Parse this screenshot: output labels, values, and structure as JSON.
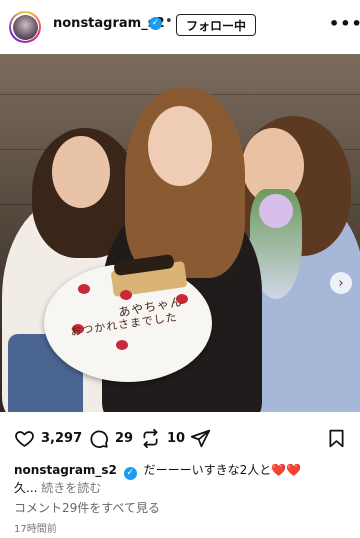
{
  "post": {
    "username": "nonstagram_s2",
    "verified_mark": "✓",
    "separator": "•",
    "follow_button": "フォロー中",
    "more_menu": "•••"
  },
  "photo": {
    "plate_text_line1": "あやちゃん",
    "plate_text_line2": "おつかれさまでした",
    "carousel_next": "›",
    "carousel_pages": 3,
    "carousel_active": 1
  },
  "actions": {
    "likes": "3,297",
    "comments": "29",
    "reposts": "10"
  },
  "caption": {
    "username": "nonstagram_s2",
    "text_line1": "だーーーいすきな2人と",
    "hearts": "❤️❤️",
    "text_line2": "久...",
    "read_more": "続きを読む"
  },
  "comments": {
    "view_all": "コメント29件をすべて見る"
  },
  "meta": {
    "posted_time": "17時間前"
  },
  "colors": {
    "verified": "#1d9bf0",
    "heart": "#e0262b",
    "muted_text": "#777777"
  }
}
